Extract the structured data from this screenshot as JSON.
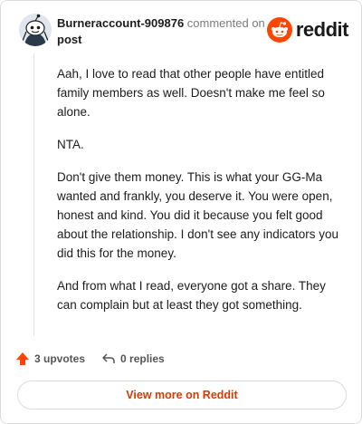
{
  "header": {
    "author": "Burneraccount-909876",
    "meta": "commented on",
    "post_link": "post",
    "brand": "reddit"
  },
  "comment": {
    "paragraphs": [
      "Aah, I love to read that other people have entitled family members as well. Doesn't make me feel so alone.",
      "NTA.",
      "Don't give them money. This is what your GG-Ma wanted and frankly, you deserve it. You were open, honest and kind. You did it because you felt good about the relationship. I don't see any indicators you did this for the money.",
      "And from what I read, everyone got a share. They can complain but at least they got something."
    ]
  },
  "actions": {
    "upvotes": "3 upvotes",
    "replies": "0 replies"
  },
  "footer": {
    "view_more": "View more on Reddit"
  },
  "colors": {
    "accent": "#ff4500",
    "link": "#d93a00"
  },
  "icons": [
    "avatar-icon",
    "reddit-logo-icon",
    "upvote-arrow-icon",
    "reply-arrow-icon"
  ]
}
